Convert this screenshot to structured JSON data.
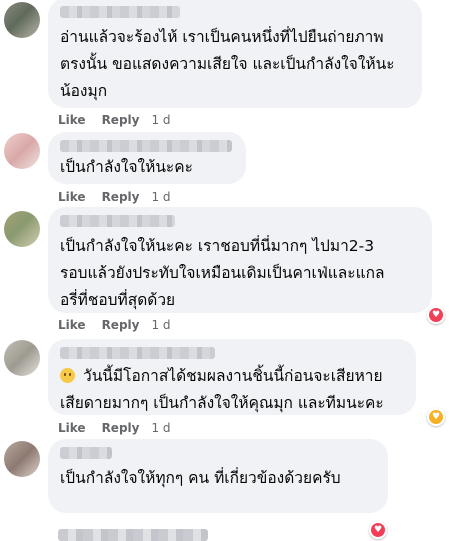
{
  "comments": [
    {
      "text": "อ่านแล้วจะร้องไห้ เราเป็นคนหนึ่งที่ไปยืนถ่ายภาพ\nตรงนั้น ขอแสดงความเสียใจ และเป็นกำลังใจให้นะ\nน้องมุก",
      "like_label": "Like",
      "reply_label": "Reply",
      "time": "1 d"
    },
    {
      "text": "เป็นกำลังใจให้นะคะ",
      "like_label": "Like",
      "reply_label": "Reply",
      "time": "1 d"
    },
    {
      "text": "เป็นกำลังใจให้นะคะ เราชอบที่นี่มากๆ ไปมา2-3\nรอบแล้วยังประทับใจเหมือนเดิมเป็นคาเฟ่และแกล\nอรี่ที่ชอบที่สุดด้วย",
      "like_label": "Like",
      "reply_label": "Reply",
      "time": "1 d",
      "reaction": "love"
    },
    {
      "text": "วันนี้มีโอกาสได้ชมผลงานชิ้นนี้ก่อนจะเสียหาย\nเสียดายมากๆ เป็นกำลังใจให้คุณมุก และทีมนะคะ",
      "like_label": "Like",
      "reply_label": "Reply",
      "time": "1 d",
      "leading_emoji": "sad-face",
      "reaction": "care"
    },
    {
      "text": "เป็นกำลังใจให้ทุกๆ คน ที่เกี่ยวข้องด้วยครับ",
      "reaction": "love"
    }
  ],
  "colors": {
    "bubble": "#f0f2f5",
    "meta": "#65676b",
    "love": "#f33e58",
    "care": "#f7b125"
  }
}
